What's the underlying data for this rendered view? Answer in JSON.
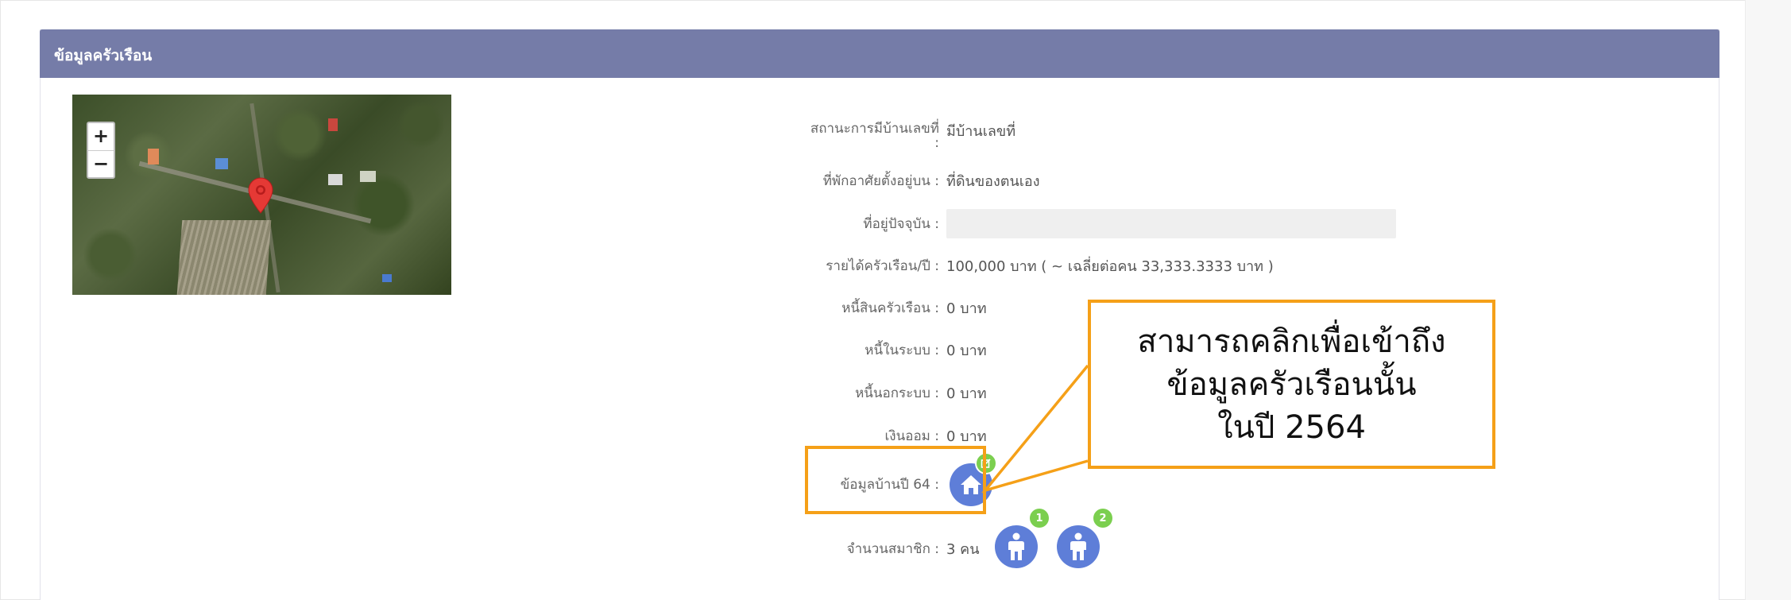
{
  "panel": {
    "title": "ข้อมูลครัวเรือน",
    "header_color": "#757ca8"
  },
  "map": {
    "zoom_in_label": "+",
    "zoom_out_label": "−",
    "marker_icon": "map-pin-icon",
    "marker_color": "#e53935"
  },
  "info": {
    "rows": [
      {
        "label": "สถานะการมีบ้านเลขที่",
        "label_suffix": ":",
        "value": "มีบ้านเลขที่"
      },
      {
        "label": "ที่พักอาศัยตั้งอยู่บน :",
        "value": "ที่ดินของตนเอง"
      },
      {
        "label": "ที่อยู่ปัจจุบัน :",
        "value": ""
      },
      {
        "label": "รายได้ครัวเรือน/ปี :",
        "value": "100,000 บาท ( ~ เฉลี่ยต่อคน 33,333.3333 บาท )"
      },
      {
        "label": "หนี้สินครัวเรือน :",
        "value": "0 บาท"
      },
      {
        "label": "หนี้ในระบบ :",
        "value": "0 บาท"
      },
      {
        "label": "หนี้นอกระบบ :",
        "value": "0 บาท"
      },
      {
        "label": "เงินออม :",
        "value": "0 บาท"
      }
    ],
    "house_data": {
      "label": "ข้อมูลบ้านปี 64 :",
      "icon": "home-icon",
      "badge_icon": "edit-icon",
      "badge_color": "#7bcf4f"
    },
    "members": {
      "label": "จำนวนสมาชิก :",
      "value": "3 คน",
      "icon": "person-icon",
      "badges": [
        "1",
        "2"
      ]
    }
  },
  "callout": {
    "lines": [
      "สามารถคลิกเพื่อเข้าถึง",
      "ข้อมูลครัวเรือนนั้น",
      "ในปี 2564"
    ],
    "border_color": "#f5a018"
  },
  "accent": "#5e7ed8"
}
